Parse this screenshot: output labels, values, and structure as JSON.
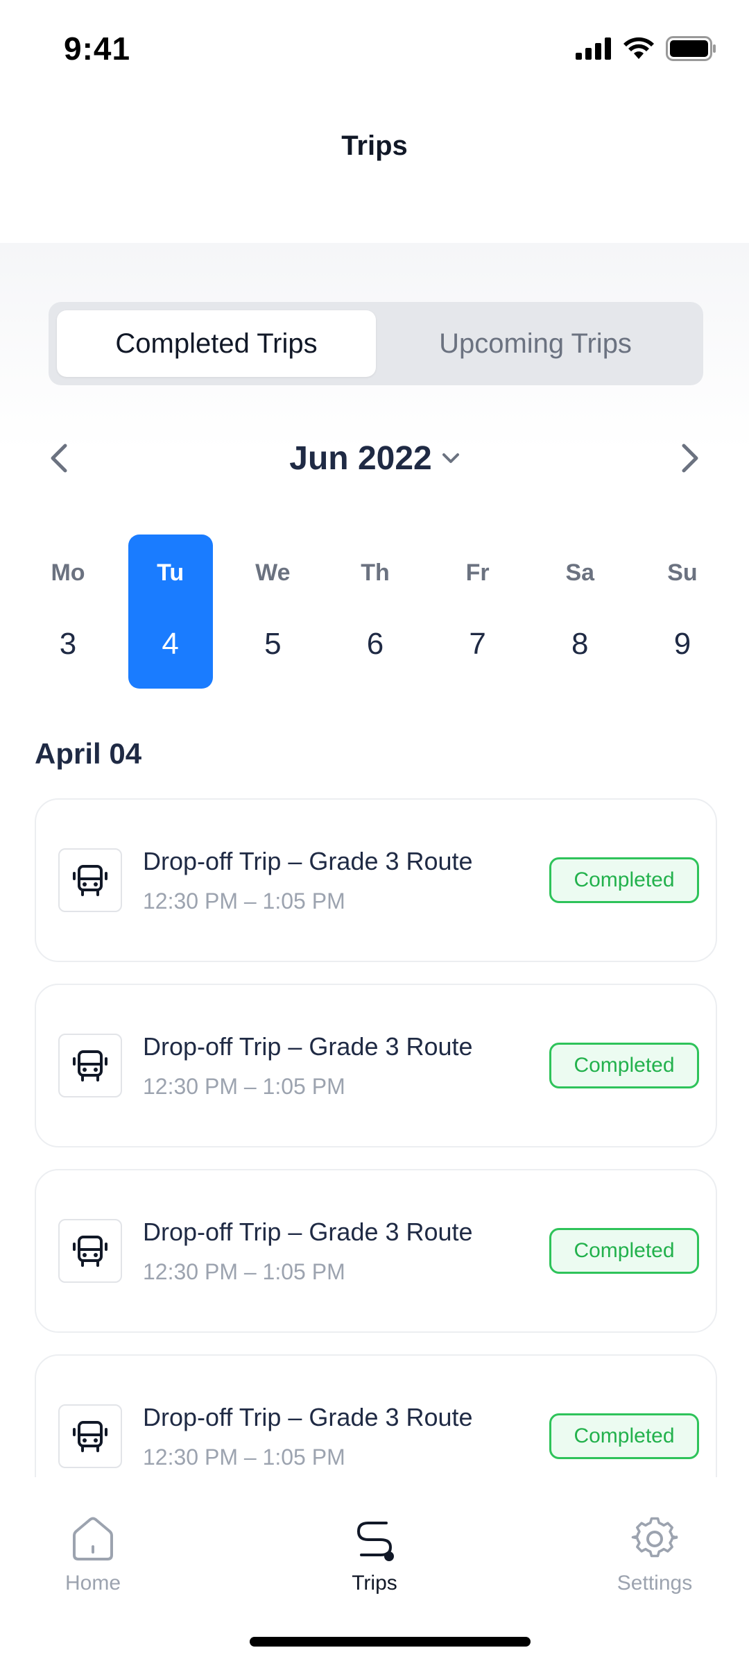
{
  "status_bar": {
    "time": "9:41"
  },
  "header": {
    "title": "Trips"
  },
  "segments": [
    {
      "label": "Completed Trips",
      "active": true
    },
    {
      "label": "Upcoming Trips",
      "active": false
    }
  ],
  "calendar": {
    "month_label": "Jun 2022",
    "days": [
      {
        "name": "Mo",
        "num": "3",
        "selected": false
      },
      {
        "name": "Tu",
        "num": "4",
        "selected": true
      },
      {
        "name": "We",
        "num": "5",
        "selected": false
      },
      {
        "name": "Th",
        "num": "6",
        "selected": false
      },
      {
        "name": "Fr",
        "num": "7",
        "selected": false
      },
      {
        "name": "Sa",
        "num": "8",
        "selected": false
      },
      {
        "name": "Su",
        "num": "9",
        "selected": false
      }
    ]
  },
  "section": {
    "title": "April 04"
  },
  "trips": [
    {
      "title": "Drop-off Trip – Grade 3 Route",
      "time": "12:30 PM – 1:05 PM",
      "status": "Completed",
      "icon": "bus-icon"
    },
    {
      "title": "Drop-off Trip – Grade 3 Route",
      "time": "12:30 PM – 1:05 PM",
      "status": "Completed",
      "icon": "bus-icon"
    },
    {
      "title": "Drop-off Trip – Grade 3 Route",
      "time": "12:30 PM – 1:05 PM",
      "status": "Completed",
      "icon": "bus-icon"
    },
    {
      "title": "Drop-off Trip – Grade 3 Route",
      "time": "12:30 PM – 1:05 PM",
      "status": "Completed",
      "icon": "bus-icon"
    }
  ],
  "tab_bar": {
    "items": [
      {
        "label": "Home",
        "icon": "home-icon",
        "active": false
      },
      {
        "label": "Trips",
        "icon": "route-icon",
        "active": true
      },
      {
        "label": "Settings",
        "icon": "gear-icon",
        "active": false
      }
    ]
  },
  "colors": {
    "accent": "#1a7cff",
    "success": "#22b14c",
    "text_primary": "#1f2a44",
    "text_muted": "#9ca3af"
  }
}
